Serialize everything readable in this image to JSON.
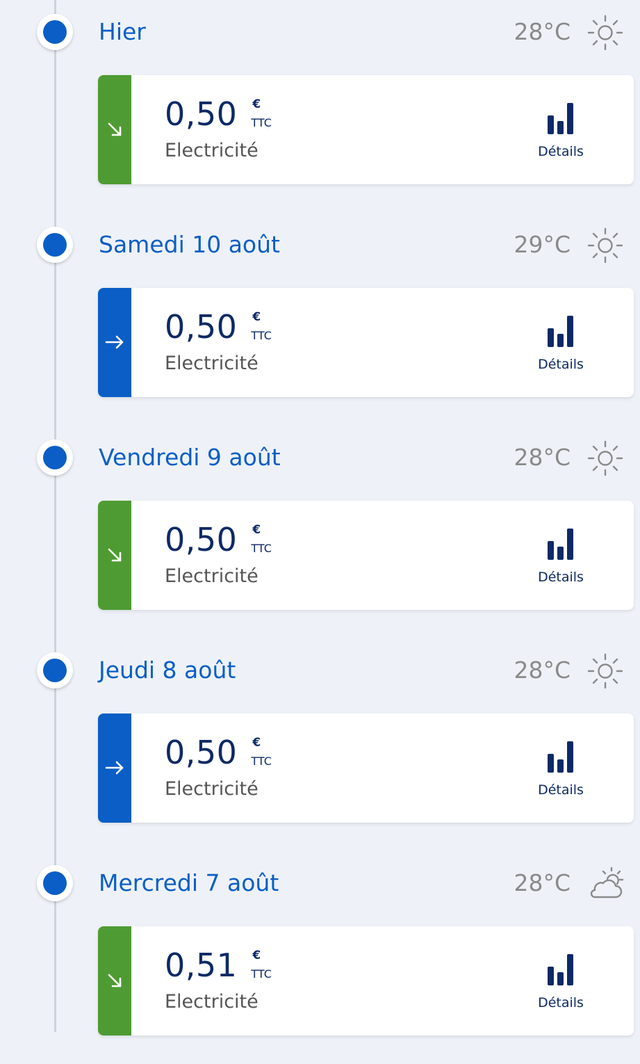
{
  "colors": {
    "background": "#eef2f8",
    "accent_blue": "#0a5ec6",
    "navy": "#0d2a66",
    "trend_down_green": "#4f9b33",
    "trend_stable_blue": "#0a5ec6",
    "muted_gray": "#8a8a8a"
  },
  "days": [
    {
      "date": "Hier",
      "temperature": "28°C",
      "weather_icon": "sun-icon",
      "trend": "down",
      "trend_icon": "arrow-down-right-icon",
      "amount": "0,50",
      "currency": "€",
      "tax": "TTC",
      "energy": "Electricité",
      "details_label": "Détails"
    },
    {
      "date": "Samedi 10 août",
      "temperature": "29°C",
      "weather_icon": "sun-icon",
      "trend": "stable",
      "trend_icon": "arrow-right-icon",
      "amount": "0,50",
      "currency": "€",
      "tax": "TTC",
      "energy": "Electricité",
      "details_label": "Détails"
    },
    {
      "date": "Vendredi 9 août",
      "temperature": "28°C",
      "weather_icon": "sun-icon",
      "trend": "down",
      "trend_icon": "arrow-down-right-icon",
      "amount": "0,50",
      "currency": "€",
      "tax": "TTC",
      "energy": "Electricité",
      "details_label": "Détails"
    },
    {
      "date": "Jeudi 8 août",
      "temperature": "28°C",
      "weather_icon": "sun-icon",
      "trend": "stable",
      "trend_icon": "arrow-right-icon",
      "amount": "0,50",
      "currency": "€",
      "tax": "TTC",
      "energy": "Electricité",
      "details_label": "Détails"
    },
    {
      "date": "Mercredi 7 août",
      "temperature": "28°C",
      "weather_icon": "cloud-sun-icon",
      "trend": "down",
      "trend_icon": "arrow-down-right-icon",
      "amount": "0,51",
      "currency": "€",
      "tax": "TTC",
      "energy": "Electricité",
      "details_label": "Détails"
    }
  ]
}
